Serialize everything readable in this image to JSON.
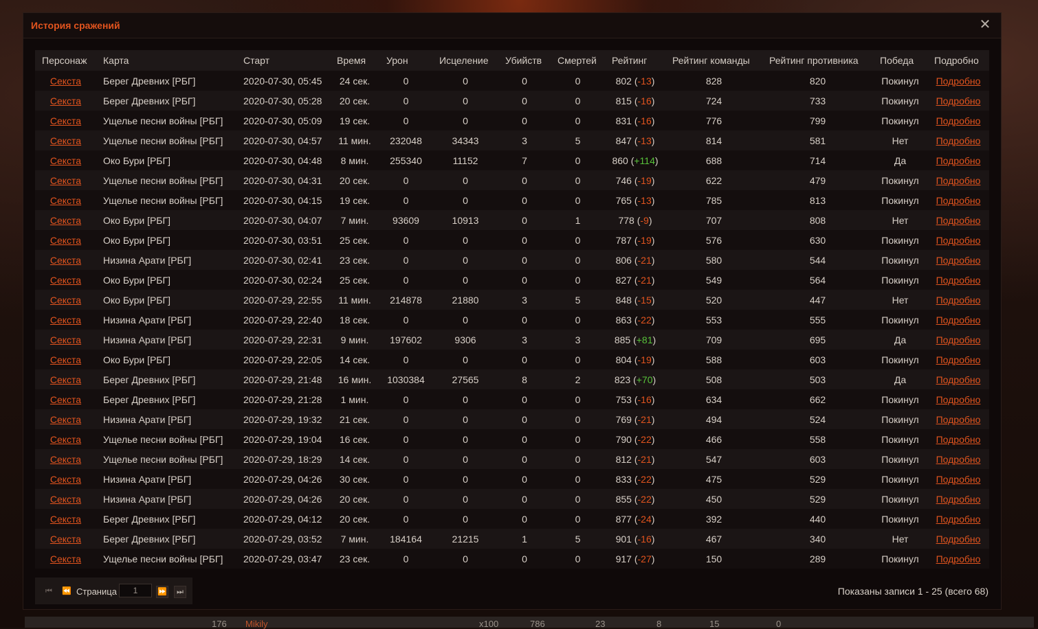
{
  "modal": {
    "title": "История сражений",
    "close_icon": "close-icon"
  },
  "columns": [
    "Персонаж",
    "Карта",
    "Старт",
    "Время",
    "Урон",
    "Исцеление",
    "Убийств",
    "Смертей",
    "Рейтинг",
    "Рейтинг команды",
    "Рейтинг противника",
    "Победа",
    "Подробно"
  ],
  "rows": [
    {
      "char": "Секста",
      "map": "Берег Древних [РБГ]",
      "start": "2020-07-30, 05:45",
      "time": "24 сек.",
      "damage": "0",
      "heal": "0",
      "kills": "0",
      "deaths": "0",
      "rating": "802",
      "change": "-13",
      "team": "828",
      "enemy": "820",
      "result": "Покинул",
      "details": "Подробно"
    },
    {
      "char": "Секста",
      "map": "Берег Древних [РБГ]",
      "start": "2020-07-30, 05:28",
      "time": "20 сек.",
      "damage": "0",
      "heal": "0",
      "kills": "0",
      "deaths": "0",
      "rating": "815",
      "change": "-16",
      "team": "724",
      "enemy": "733",
      "result": "Покинул",
      "details": "Подробно"
    },
    {
      "char": "Секста",
      "map": "Ущелье песни войны [РБГ]",
      "start": "2020-07-30, 05:09",
      "time": "19 сек.",
      "damage": "0",
      "heal": "0",
      "kills": "0",
      "deaths": "0",
      "rating": "831",
      "change": "-16",
      "team": "776",
      "enemy": "799",
      "result": "Покинул",
      "details": "Подробно"
    },
    {
      "char": "Секста",
      "map": "Ущелье песни войны [РБГ]",
      "start": "2020-07-30, 04:57",
      "time": "11 мин.",
      "damage": "232048",
      "heal": "34343",
      "kills": "3",
      "deaths": "5",
      "rating": "847",
      "change": "-13",
      "team": "814",
      "enemy": "581",
      "result": "Нет",
      "details": "Подробно"
    },
    {
      "char": "Секста",
      "map": "Око Бури [РБГ]",
      "start": "2020-07-30, 04:48",
      "time": "8 мин.",
      "damage": "255340",
      "heal": "11152",
      "kills": "7",
      "deaths": "0",
      "rating": "860",
      "change": "+114",
      "team": "688",
      "enemy": "714",
      "result": "Да",
      "details": "Подробно"
    },
    {
      "char": "Секста",
      "map": "Ущелье песни войны [РБГ]",
      "start": "2020-07-30, 04:31",
      "time": "20 сек.",
      "damage": "0",
      "heal": "0",
      "kills": "0",
      "deaths": "0",
      "rating": "746",
      "change": "-19",
      "team": "622",
      "enemy": "479",
      "result": "Покинул",
      "details": "Подробно"
    },
    {
      "char": "Секста",
      "map": "Ущелье песни войны [РБГ]",
      "start": "2020-07-30, 04:15",
      "time": "19 сек.",
      "damage": "0",
      "heal": "0",
      "kills": "0",
      "deaths": "0",
      "rating": "765",
      "change": "-13",
      "team": "785",
      "enemy": "813",
      "result": "Покинул",
      "details": "Подробно"
    },
    {
      "char": "Секста",
      "map": "Око Бури [РБГ]",
      "start": "2020-07-30, 04:07",
      "time": "7 мин.",
      "damage": "93609",
      "heal": "10913",
      "kills": "0",
      "deaths": "1",
      "rating": "778",
      "change": "-9",
      "team": "707",
      "enemy": "808",
      "result": "Нет",
      "details": "Подробно"
    },
    {
      "char": "Секста",
      "map": "Око Бури [РБГ]",
      "start": "2020-07-30, 03:51",
      "time": "25 сек.",
      "damage": "0",
      "heal": "0",
      "kills": "0",
      "deaths": "0",
      "rating": "787",
      "change": "-19",
      "team": "576",
      "enemy": "630",
      "result": "Покинул",
      "details": "Подробно"
    },
    {
      "char": "Секста",
      "map": "Низина Арати [РБГ]",
      "start": "2020-07-30, 02:41",
      "time": "23 сек.",
      "damage": "0",
      "heal": "0",
      "kills": "0",
      "deaths": "0",
      "rating": "806",
      "change": "-21",
      "team": "580",
      "enemy": "544",
      "result": "Покинул",
      "details": "Подробно"
    },
    {
      "char": "Секста",
      "map": "Око Бури [РБГ]",
      "start": "2020-07-30, 02:24",
      "time": "25 сек.",
      "damage": "0",
      "heal": "0",
      "kills": "0",
      "deaths": "0",
      "rating": "827",
      "change": "-21",
      "team": "549",
      "enemy": "564",
      "result": "Покинул",
      "details": "Подробно"
    },
    {
      "char": "Секста",
      "map": "Око Бури [РБГ]",
      "start": "2020-07-29, 22:55",
      "time": "11 мин.",
      "damage": "214878",
      "heal": "21880",
      "kills": "3",
      "deaths": "5",
      "rating": "848",
      "change": "-15",
      "team": "520",
      "enemy": "447",
      "result": "Нет",
      "details": "Подробно"
    },
    {
      "char": "Секста",
      "map": "Низина Арати [РБГ]",
      "start": "2020-07-29, 22:40",
      "time": "18 сек.",
      "damage": "0",
      "heal": "0",
      "kills": "0",
      "deaths": "0",
      "rating": "863",
      "change": "-22",
      "team": "553",
      "enemy": "555",
      "result": "Покинул",
      "details": "Подробно"
    },
    {
      "char": "Секста",
      "map": "Низина Арати [РБГ]",
      "start": "2020-07-29, 22:31",
      "time": "9 мин.",
      "damage": "197602",
      "heal": "9306",
      "kills": "3",
      "deaths": "3",
      "rating": "885",
      "change": "+81",
      "team": "709",
      "enemy": "695",
      "result": "Да",
      "details": "Подробно"
    },
    {
      "char": "Секста",
      "map": "Око Бури [РБГ]",
      "start": "2020-07-29, 22:05",
      "time": "14 сек.",
      "damage": "0",
      "heal": "0",
      "kills": "0",
      "deaths": "0",
      "rating": "804",
      "change": "-19",
      "team": "588",
      "enemy": "603",
      "result": "Покинул",
      "details": "Подробно"
    },
    {
      "char": "Секста",
      "map": "Берег Древних [РБГ]",
      "start": "2020-07-29, 21:48",
      "time": "16 мин.",
      "damage": "1030384",
      "heal": "27565",
      "kills": "8",
      "deaths": "2",
      "rating": "823",
      "change": "+70",
      "team": "508",
      "enemy": "503",
      "result": "Да",
      "details": "Подробно"
    },
    {
      "char": "Секста",
      "map": "Берег Древних [РБГ]",
      "start": "2020-07-29, 21:28",
      "time": "1 мин.",
      "damage": "0",
      "heal": "0",
      "kills": "0",
      "deaths": "0",
      "rating": "753",
      "change": "-16",
      "team": "634",
      "enemy": "662",
      "result": "Покинул",
      "details": "Подробно"
    },
    {
      "char": "Секста",
      "map": "Низина Арати [РБГ]",
      "start": "2020-07-29, 19:32",
      "time": "21 сек.",
      "damage": "0",
      "heal": "0",
      "kills": "0",
      "deaths": "0",
      "rating": "769",
      "change": "-21",
      "team": "494",
      "enemy": "524",
      "result": "Покинул",
      "details": "Подробно"
    },
    {
      "char": "Секста",
      "map": "Ущелье песни войны [РБГ]",
      "start": "2020-07-29, 19:04",
      "time": "16 сек.",
      "damage": "0",
      "heal": "0",
      "kills": "0",
      "deaths": "0",
      "rating": "790",
      "change": "-22",
      "team": "466",
      "enemy": "558",
      "result": "Покинул",
      "details": "Подробно"
    },
    {
      "char": "Секста",
      "map": "Ущелье песни войны [РБГ]",
      "start": "2020-07-29, 18:29",
      "time": "14 сек.",
      "damage": "0",
      "heal": "0",
      "kills": "0",
      "deaths": "0",
      "rating": "812",
      "change": "-21",
      "team": "547",
      "enemy": "603",
      "result": "Покинул",
      "details": "Подробно"
    },
    {
      "char": "Секста",
      "map": "Низина Арати [РБГ]",
      "start": "2020-07-29, 04:26",
      "time": "30 сек.",
      "damage": "0",
      "heal": "0",
      "kills": "0",
      "deaths": "0",
      "rating": "833",
      "change": "-22",
      "team": "475",
      "enemy": "529",
      "result": "Покинул",
      "details": "Подробно"
    },
    {
      "char": "Секста",
      "map": "Низина Арати [РБГ]",
      "start": "2020-07-29, 04:26",
      "time": "20 сек.",
      "damage": "0",
      "heal": "0",
      "kills": "0",
      "deaths": "0",
      "rating": "855",
      "change": "-22",
      "team": "450",
      "enemy": "529",
      "result": "Покинул",
      "details": "Подробно"
    },
    {
      "char": "Секста",
      "map": "Берег Древних [РБГ]",
      "start": "2020-07-29, 04:12",
      "time": "20 сек.",
      "damage": "0",
      "heal": "0",
      "kills": "0",
      "deaths": "0",
      "rating": "877",
      "change": "-24",
      "team": "392",
      "enemy": "440",
      "result": "Покинул",
      "details": "Подробно"
    },
    {
      "char": "Секста",
      "map": "Берег Древних [РБГ]",
      "start": "2020-07-29, 03:52",
      "time": "7 мин.",
      "damage": "184164",
      "heal": "21215",
      "kills": "1",
      "deaths": "5",
      "rating": "901",
      "change": "-16",
      "team": "467",
      "enemy": "340",
      "result": "Нет",
      "details": "Подробно"
    },
    {
      "char": "Секста",
      "map": "Ущелье песни войны [РБГ]",
      "start": "2020-07-29, 03:47",
      "time": "23 сек.",
      "damage": "0",
      "heal": "0",
      "kills": "0",
      "deaths": "0",
      "rating": "917",
      "change": "-27",
      "team": "150",
      "enemy": "289",
      "result": "Покинул",
      "details": "Подробно"
    }
  ],
  "pager": {
    "label": "Страница",
    "page": "1",
    "first_icon": "first-page-icon",
    "prev_icon": "prev-page-icon",
    "next_icon": "next-page-icon",
    "last_icon": "last-page-icon"
  },
  "records_info": "Показаны записи 1 - 25 (всего 68)",
  "bottom_strip": {
    "rank": "176",
    "name": "Mikily",
    "mult": "x100",
    "v1": "786",
    "v2": "23",
    "v3": "8",
    "v4": "15",
    "v5": "0"
  },
  "colors": {
    "accent": "#e2541e",
    "positive": "#58c23a"
  }
}
